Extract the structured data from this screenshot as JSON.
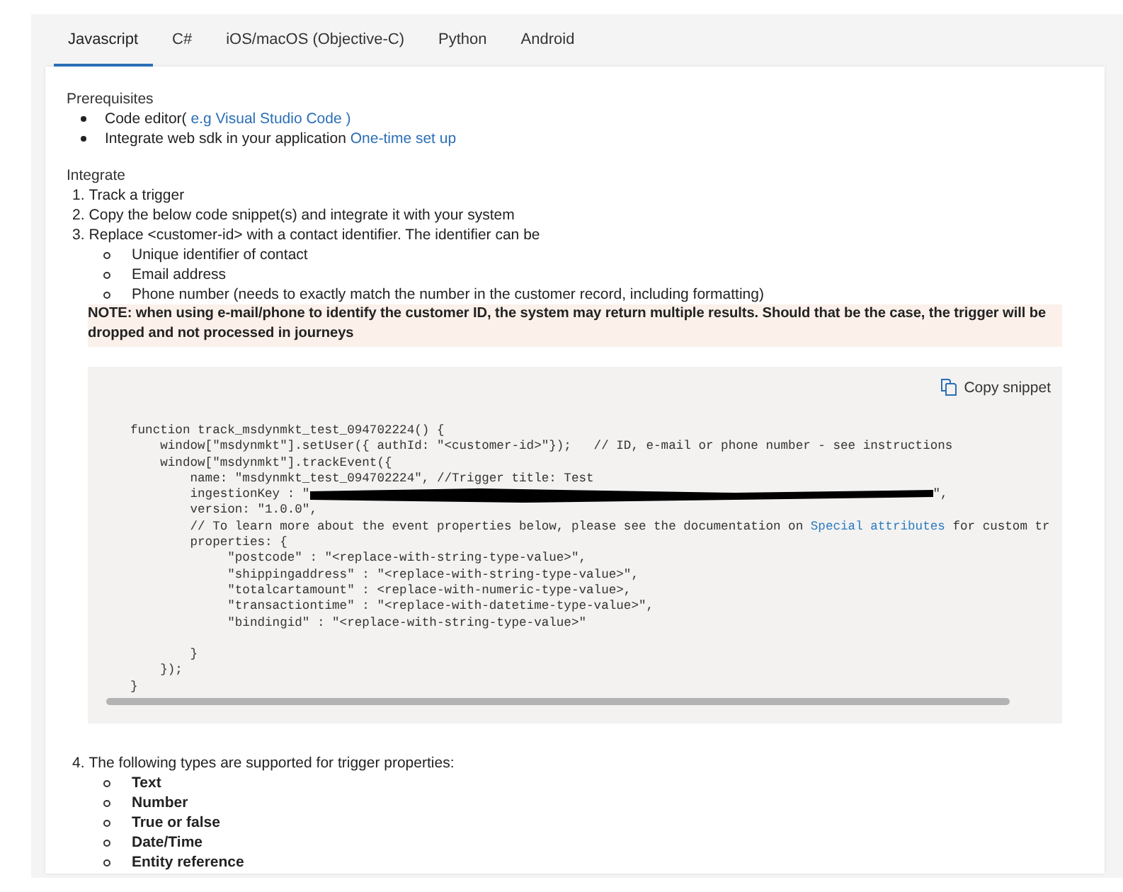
{
  "tabs": [
    {
      "label": "Javascript",
      "selected": true
    },
    {
      "label": "C#",
      "selected": false
    },
    {
      "label": "iOS/macOS (Objective-C)",
      "selected": false
    },
    {
      "label": "Python",
      "selected": false
    },
    {
      "label": "Android",
      "selected": false
    }
  ],
  "prerequisites": {
    "heading": "Prerequisites",
    "items": [
      [
        {
          "kind": "text",
          "text": "Code editor("
        },
        {
          "kind": "link",
          "text": " e.g Visual Studio Code )"
        }
      ],
      [
        {
          "kind": "text",
          "text": "Integrate web sdk in your application "
        },
        {
          "kind": "link",
          "text": "One-time set up"
        }
      ]
    ]
  },
  "integrate": {
    "heading": "Integrate",
    "steps": [
      {
        "number": "1.",
        "text": "Track a trigger"
      },
      {
        "number": "2.",
        "text": "Copy the below code snippet(s) and integrate it with your system"
      },
      {
        "number": "3.",
        "text": "Replace <customer-id> with a contact identifier. The identifier can be",
        "items": [
          "Unique identifier of contact",
          "Email address",
          "Phone number (needs to exactly match the number in the customer record, including formatting)"
        ]
      }
    ],
    "note": "NOTE: when using e-mail/phone to identify the customer ID, the system may return multiple results. Should that be the case, the trigger will be dropped and not processed in journeys",
    "snippet": {
      "copy_label": "Copy snippet",
      "lines": [
        [
          {
            "kind": "code",
            "text": "function track_msdynmkt_test_094702224() {"
          }
        ],
        [
          {
            "kind": "code",
            "text": "    window[\"msdynmkt\"].setUser({ authId: \"<customer-id>\"});   // ID, e-mail or phone number - see instructions"
          }
        ],
        [
          {
            "kind": "code",
            "text": "    window[\"msdynmkt\"].trackEvent({"
          }
        ],
        [
          {
            "kind": "code",
            "text": "        name: \"msdynmkt_test_094702224\", //Trigger title: Test"
          }
        ],
        [
          {
            "kind": "code",
            "text": "        ingestionKey : \""
          },
          {
            "kind": "redaction"
          },
          {
            "kind": "code",
            "text": "\","
          }
        ],
        [
          {
            "kind": "code",
            "text": "        version: \"1.0.0\","
          }
        ],
        [
          {
            "kind": "code",
            "text": "        // To learn more about the event properties below, please see the documentation on "
          },
          {
            "kind": "link",
            "text": "Special attributes"
          },
          {
            "kind": "code",
            "text": " for custom tr"
          }
        ],
        [
          {
            "kind": "code",
            "text": "        properties: {"
          }
        ],
        [
          {
            "kind": "code",
            "text": "             \"postcode\" : \"<replace-with-string-type-value>\","
          }
        ],
        [
          {
            "kind": "code",
            "text": "             \"shippingaddress\" : \"<replace-with-string-type-value>\","
          }
        ],
        [
          {
            "kind": "code",
            "text": "             \"totalcartamount\" : <replace-with-numeric-type-value>,"
          }
        ],
        [
          {
            "kind": "code",
            "text": "             \"transactiontime\" : \"<replace-with-datetime-type-value>\","
          }
        ],
        [
          {
            "kind": "code",
            "text": "             \"bindingid\" : \"<replace-with-string-type-value>\""
          }
        ],
        [
          {
            "kind": "blank"
          }
        ],
        [
          {
            "kind": "code",
            "text": "        }"
          }
        ],
        [
          {
            "kind": "code",
            "text": "    });"
          }
        ],
        [
          {
            "kind": "code",
            "text": "}"
          }
        ]
      ]
    },
    "final_step": {
      "number": "4.",
      "text": "The following types are supported for trigger properties:",
      "items": [
        "Text",
        "Number",
        "True or false",
        "Date/Time",
        "Entity reference"
      ]
    }
  }
}
